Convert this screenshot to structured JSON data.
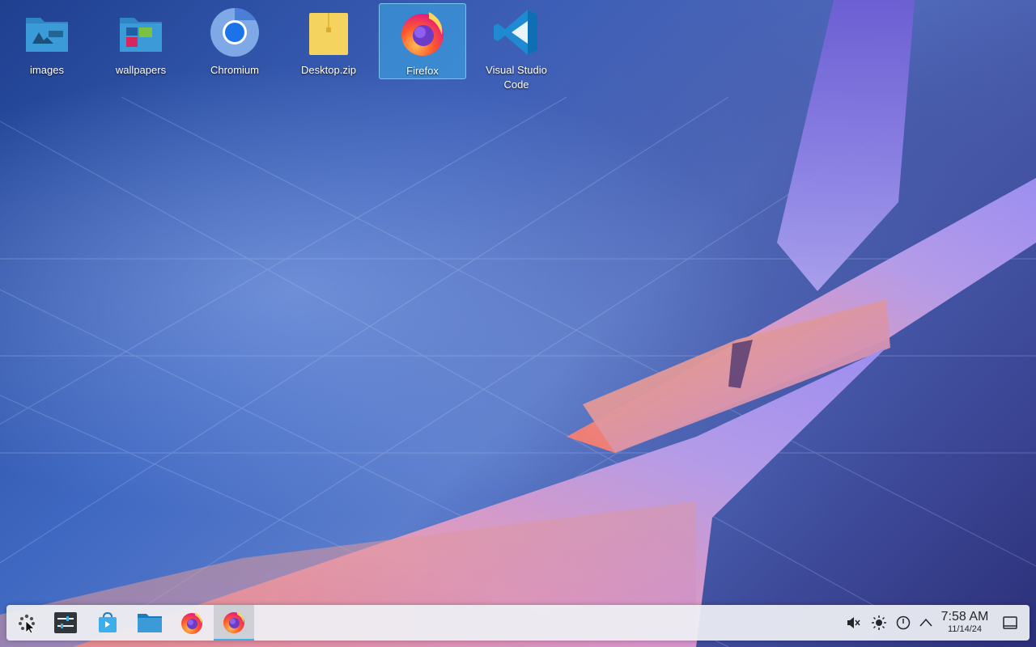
{
  "desktop": {
    "icons": [
      {
        "label": "images",
        "icon": "folder-images-icon"
      },
      {
        "label": "wallpapers",
        "icon": "folder-wallpapers-icon"
      },
      {
        "label": "Chromium",
        "icon": "chromium-icon"
      },
      {
        "label": "Desktop.zip",
        "icon": "zip-archive-icon"
      },
      {
        "label": "Firefox",
        "icon": "firefox-icon",
        "selected": true
      },
      {
        "label": "Visual Studio Code",
        "icon": "vscode-icon"
      }
    ]
  },
  "taskbar": {
    "launchers": [
      {
        "name": "application-launcher",
        "icon": "kde-launcher-icon"
      },
      {
        "name": "system-settings",
        "icon": "settings-sliders-icon"
      },
      {
        "name": "discover",
        "icon": "software-store-icon"
      },
      {
        "name": "file-manager",
        "icon": "folder-icon"
      },
      {
        "name": "firefox",
        "icon": "firefox-icon"
      },
      {
        "name": "firefox-window",
        "icon": "firefox-icon",
        "active": true
      }
    ],
    "tray": [
      {
        "name": "volume-muted",
        "icon": "speaker-muted-icon"
      },
      {
        "name": "brightness",
        "icon": "brightness-icon"
      },
      {
        "name": "power",
        "icon": "power-icon"
      },
      {
        "name": "show-hidden",
        "icon": "chevron-up-icon"
      }
    ],
    "clock": {
      "time": "7:58 AM",
      "date": "11/14/24"
    },
    "show_desktop": {
      "icon": "show-desktop-icon"
    }
  },
  "colors": {
    "selection": "#3daee9",
    "panel": "#eef0f4",
    "folder": "#3a9bd8",
    "zip": "#f4d35e"
  }
}
